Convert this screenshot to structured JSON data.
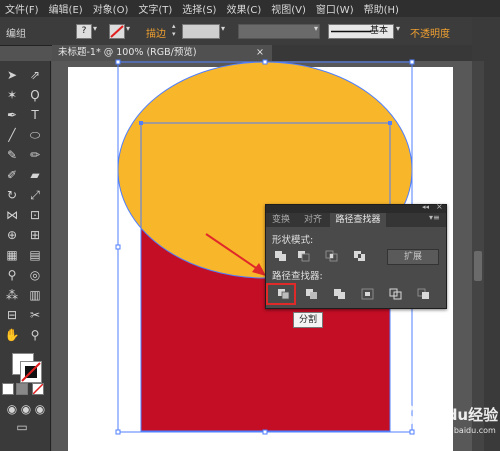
{
  "menu": [
    "文件(F)",
    "编辑(E)",
    "对象(O)",
    "文字(T)",
    "选择(S)",
    "效果(C)",
    "视图(V)",
    "窗口(W)",
    "帮助(H)"
  ],
  "control_bar": {
    "mode_label": "编组",
    "help_symbol": "?",
    "stroke_label": "描边",
    "stroke_value": "",
    "style_label": "基本",
    "opacity_label": "不透明度"
  },
  "document_tab": {
    "title": "未标题-1* @ 100% (RGB/预览)",
    "close": "×"
  },
  "canvas": {
    "ellipse_color": "#f8b62b",
    "rect_color": "#c40e25",
    "selection_color": "#4f7fff"
  },
  "pathfinder_panel": {
    "tabs": [
      "变换",
      "对齐",
      "路径查找器"
    ],
    "active_tab": "路径查找器",
    "shape_modes_label": "形状模式:",
    "expand_label": "扩展",
    "pathfinders_label": "路径查找器:",
    "collapse_glyph": "◂◂",
    "close_glyph": "×",
    "menu_glyph": "▾≡"
  },
  "tooltip": "分割",
  "watermark": {
    "brand": "Baidu经验",
    "url": "jingyan.baidu.com"
  },
  "annotation_color": "#e02a2a"
}
